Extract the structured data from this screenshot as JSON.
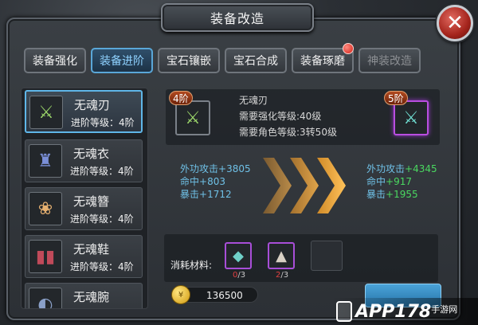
{
  "window": {
    "title": "装备改造",
    "close_icon": "close-icon"
  },
  "tabs": [
    {
      "label": "装备强化",
      "state": "normal"
    },
    {
      "label": "装备进阶",
      "state": "active"
    },
    {
      "label": "宝石镶嵌",
      "state": "normal"
    },
    {
      "label": "宝石合成",
      "state": "normal"
    },
    {
      "label": "装备琢磨",
      "state": "normal",
      "badge": true
    },
    {
      "label": "神装改造",
      "state": "disabled"
    }
  ],
  "equipment_list": [
    {
      "name": "无魂刃",
      "level": "进阶等级：4阶",
      "icon": "sword-icon",
      "selected": true
    },
    {
      "name": "无魂衣",
      "level": "进阶等级：4阶",
      "icon": "armor-icon",
      "selected": false
    },
    {
      "name": "无魂簪",
      "level": "进阶等级：4阶",
      "icon": "hairpin-icon",
      "selected": false
    },
    {
      "name": "无魂鞋",
      "level": "进阶等级：4阶",
      "icon": "boots-icon",
      "selected": false
    },
    {
      "name": "无魂腕",
      "level": "",
      "icon": "bracer-icon",
      "selected": false
    }
  ],
  "upgrade": {
    "current_rank": "4阶",
    "next_rank": "5阶",
    "item_name": "无魂刃",
    "req_strengthen": "需要强化等级:40级",
    "req_char": "需要角色等级:3转50级"
  },
  "stats_before": [
    {
      "key": "外功攻击",
      "value": "+3805"
    },
    {
      "key": "命中",
      "value": "+803"
    },
    {
      "key": "暴击",
      "value": "+1712"
    }
  ],
  "stats_after": [
    {
      "key": "外功攻击",
      "value": "+4345"
    },
    {
      "key": "命中",
      "value": "+917"
    },
    {
      "key": "暴击",
      "value": "+1955"
    }
  ],
  "materials": {
    "label": "消耗材料:",
    "items": [
      {
        "icon": "jade-icon",
        "have": "0",
        "need": "/3"
      },
      {
        "icon": "stone-icon",
        "have": "2",
        "need": "/3"
      }
    ]
  },
  "gold": {
    "amount": "136500",
    "coin_glyph": "¥"
  },
  "watermark": {
    "brand": "APP178",
    "sub": "手游网"
  },
  "colors": {
    "accent": "#5fb6e8",
    "stat_blue": "#6fc0e6",
    "stat_green": "#4ad860",
    "alert_red": "#e04040"
  }
}
